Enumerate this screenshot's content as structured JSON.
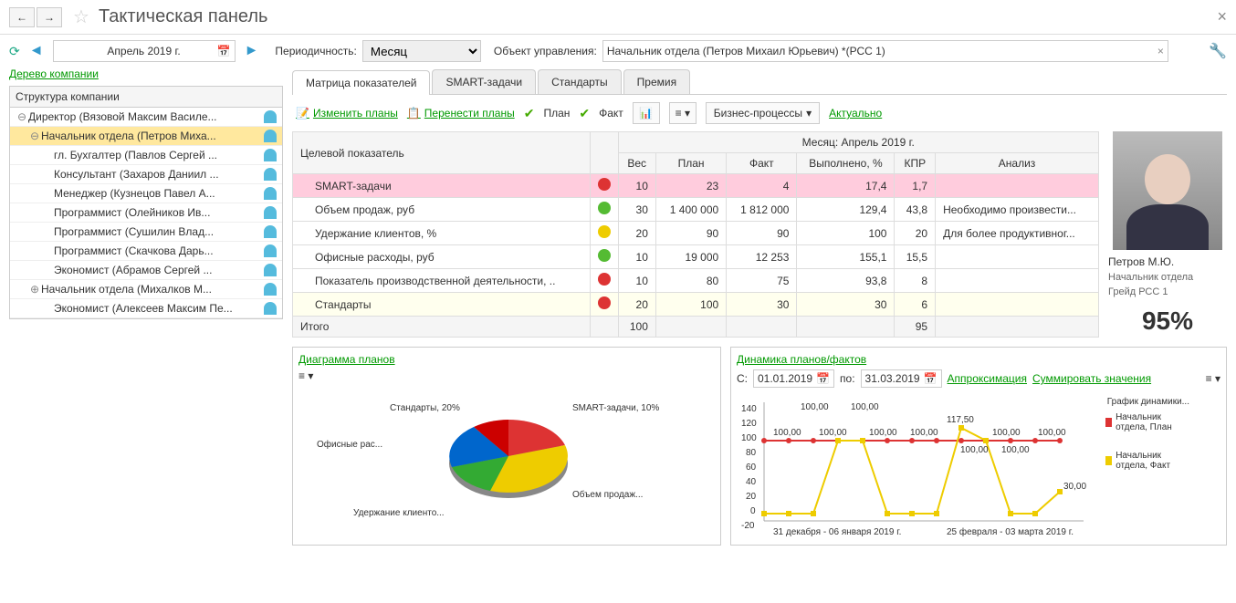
{
  "title": "Тактическая панель",
  "period": "Апрель 2019 г.",
  "periodicity_label": "Периодичность:",
  "periodicity_value": "Месяц",
  "object_label": "Объект управления:",
  "object_value": "Начальник отдела (Петров Михаил Юрьевич) *(РСС 1)",
  "tree_link": "Дерево компании",
  "tree_header": "Структура компании",
  "tree": [
    {
      "exp": "⊖",
      "indent": 0,
      "text": "Директор (Вязовой Максим Василе...",
      "sel": false
    },
    {
      "exp": "⊖",
      "indent": 1,
      "text": "Начальник отдела (Петров Миха...",
      "sel": true
    },
    {
      "exp": "",
      "indent": 2,
      "text": "гл. Бухгалтер (Павлов Сергей ...",
      "sel": false
    },
    {
      "exp": "",
      "indent": 2,
      "text": "Консультант (Захаров Даниил ...",
      "sel": false
    },
    {
      "exp": "",
      "indent": 2,
      "text": "Менеджер (Кузнецов Павел А...",
      "sel": false
    },
    {
      "exp": "",
      "indent": 2,
      "text": "Программист (Олейников Ив...",
      "sel": false
    },
    {
      "exp": "",
      "indent": 2,
      "text": "Программист (Сушилин Влад...",
      "sel": false
    },
    {
      "exp": "",
      "indent": 2,
      "text": "Программист (Скачкова Дарь...",
      "sel": false
    },
    {
      "exp": "",
      "indent": 2,
      "text": "Экономист (Абрамов Сергей ...",
      "sel": false
    },
    {
      "exp": "⊕",
      "indent": 1,
      "text": "Начальник отдела (Михалков М...",
      "sel": false
    },
    {
      "exp": "",
      "indent": 2,
      "text": "Экономист (Алексеев Максим Пе...",
      "sel": false
    }
  ],
  "tabs": [
    "Матрица показателей",
    "SMART-задачи",
    "Стандарты",
    "Премия"
  ],
  "subtb": {
    "edit_plans": "Изменить планы",
    "move_plans": "Перенести планы",
    "plan": "План",
    "fact": "Факт",
    "biz": "Бизнес-процессы",
    "actual": "Актуально"
  },
  "matrix": {
    "h_indicator": "Целевой показатель",
    "h_month": "Месяц: Апрель 2019 г.",
    "h_weight": "Вес",
    "h_plan": "План",
    "h_fact": "Факт",
    "h_done": "Выполнено, %",
    "h_kpr": "КПР",
    "h_analysis": "Анализ",
    "rows": [
      {
        "name": "SMART-задачи",
        "status": "red",
        "w": "10",
        "plan": "23",
        "fact": "4",
        "done": "17,4",
        "kpr": "1,7",
        "an": "",
        "cls": "pink"
      },
      {
        "name": "Объем продаж, руб",
        "status": "green",
        "w": "30",
        "plan": "1 400 000",
        "fact": "1 812 000",
        "done": "129,4",
        "kpr": "43,8",
        "an": "Необходимо произвести...",
        "cls": ""
      },
      {
        "name": "Удержание клиентов, %",
        "status": "yellow",
        "w": "20",
        "plan": "90",
        "fact": "90",
        "done": "100",
        "kpr": "20",
        "an": "Для более продуктивног...",
        "cls": ""
      },
      {
        "name": "Офисные расходы, руб",
        "status": "green",
        "w": "10",
        "plan": "19 000",
        "fact": "12 253",
        "done": "155,1",
        "kpr": "15,5",
        "an": "",
        "cls": ""
      },
      {
        "name": "Показатель производственной деятельности, ..",
        "status": "red",
        "w": "10",
        "plan": "80",
        "fact": "75",
        "done": "93,8",
        "kpr": "8",
        "an": "",
        "cls": ""
      },
      {
        "name": "Стандарты",
        "status": "red",
        "w": "20",
        "plan": "100",
        "fact": "30",
        "done": "30",
        "kpr": "6",
        "an": "",
        "cls": "yellow"
      }
    ],
    "total_label": "Итого",
    "total_w": "100",
    "total_kpr": "95"
  },
  "profile": {
    "name": "Петров М.Ю.",
    "role": "Начальник отдела",
    "grade": "Грейд РСС 1",
    "score": "95%"
  },
  "pie": {
    "title": "Диаграмма планов",
    "labels": {
      "standards": "Стандарты, 20%",
      "smart": "SMART-задачи, 10%",
      "office": "Офисные рас...",
      "sales": "Объем продаж...",
      "retention": "Удержание клиенто..."
    }
  },
  "line": {
    "title": "Динамика планов/фактов",
    "from_lbl": "С:",
    "from": "01.01.2019",
    "to_lbl": "по:",
    "to": "31.03.2019",
    "approx": "Аппроксимация",
    "sum": "Суммировать значения",
    "legend_title": "График динамики...",
    "legend1": "Начальник отдела, План",
    "legend2": "Начальник отдела, Факт",
    "xlabels": [
      "31 декабря - 06 января 2019 г.",
      "25 февраля - 03 марта 2019 г."
    ]
  },
  "chart_data": [
    {
      "type": "pie",
      "title": "Диаграмма планов",
      "categories": [
        "SMART-задачи",
        "Объем продаж",
        "Удержание клиентов",
        "Офисные расходы",
        "Показатель производственной деятельности",
        "Стандарты"
      ],
      "values": [
        10,
        30,
        20,
        10,
        10,
        20
      ]
    },
    {
      "type": "line",
      "title": "Динамика планов/фактов",
      "ylim": [
        -20,
        140
      ],
      "x": [
        1,
        2,
        3,
        4,
        5,
        6,
        7,
        8,
        9,
        10,
        11,
        12,
        13
      ],
      "series": [
        {
          "name": "Начальник отдела, План",
          "values": [
            100,
            100,
            100,
            100,
            100,
            100,
            100,
            100,
            100,
            100,
            100,
            100,
            100
          ]
        },
        {
          "name": "Начальник отдела, Факт",
          "values": [
            0,
            0,
            0,
            100,
            100,
            0,
            0,
            0,
            117.5,
            100,
            0,
            0,
            30
          ]
        }
      ],
      "data_labels_plan": [
        "100,00",
        "100,00",
        "100,00",
        "100,00",
        "100,00",
        "100,00",
        "100,00",
        "100,00",
        "100,00",
        "100,00",
        "100,00",
        "100,00",
        "100,00"
      ],
      "data_labels_fact_end": "30,00",
      "data_labels_fact_peak": "117,50"
    }
  ]
}
